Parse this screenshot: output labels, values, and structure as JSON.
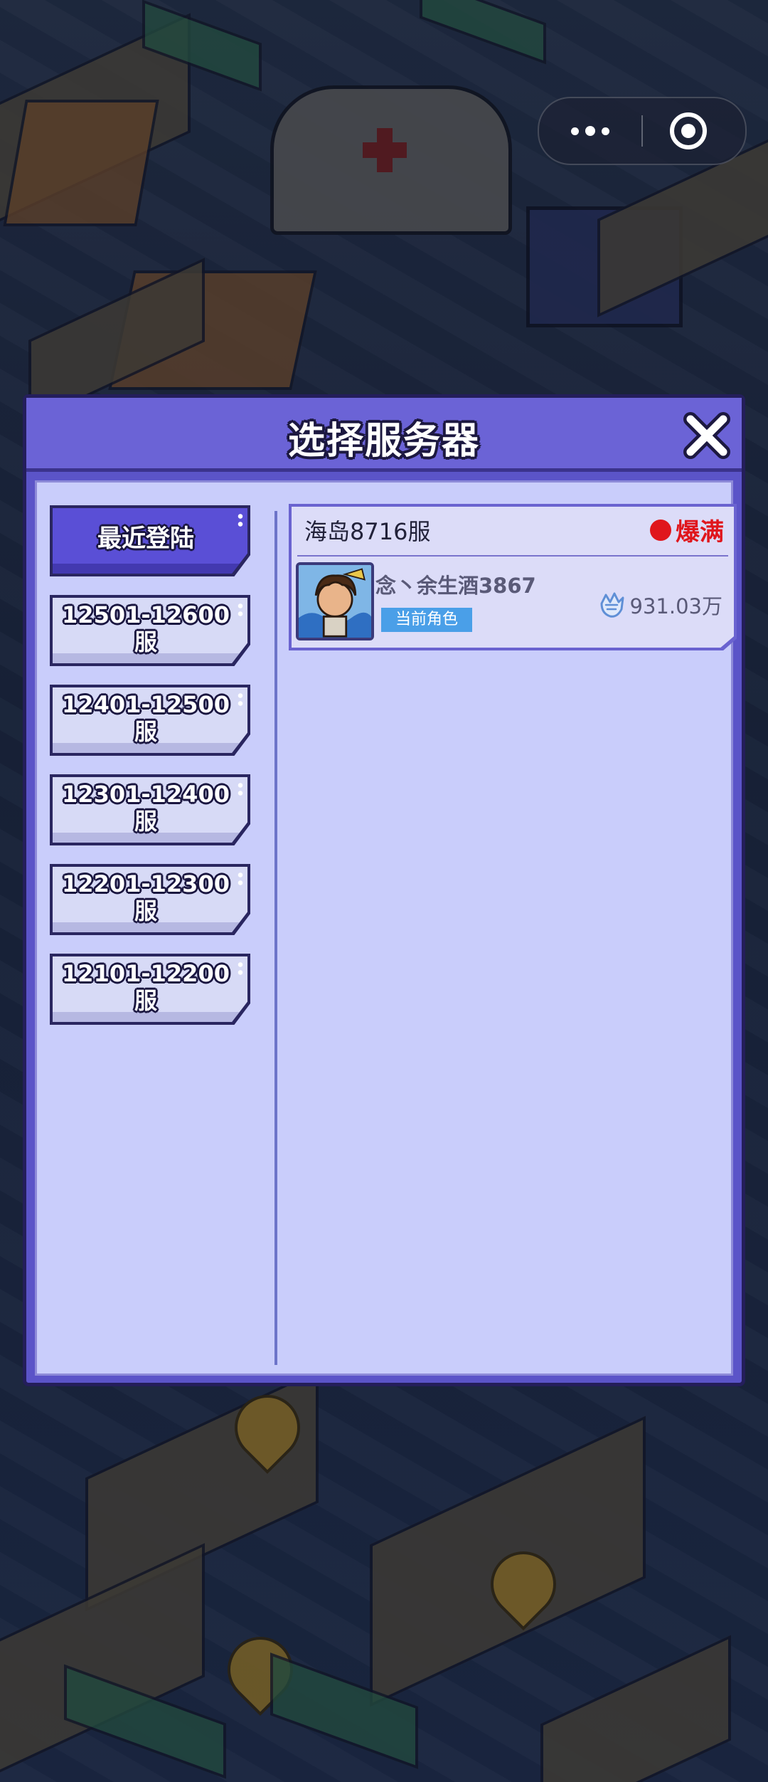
{
  "capsule": {
    "more_icon": "more-dots-icon",
    "close_icon": "mini-program-close-icon"
  },
  "dialog": {
    "title": "选择服务器",
    "close_icon": "close-x-icon"
  },
  "categories": [
    {
      "label": "最近登陆",
      "active": true
    },
    {
      "label": "12501-12600服",
      "active": false
    },
    {
      "label": "12401-12500服",
      "active": false
    },
    {
      "label": "12301-12400服",
      "active": false
    },
    {
      "label": "12201-12300服",
      "active": false
    },
    {
      "label": "12101-12200服",
      "active": false
    }
  ],
  "server": {
    "name": "海岛8716服",
    "status_label": "爆满",
    "status_color": "#e0161c",
    "role_name": "念丶余生酒3867",
    "role_tag": "当前角色",
    "power_value": "931.03万",
    "power_icon": "fist-power-icon",
    "avatar_icon": "character-avatar"
  },
  "colors": {
    "dialog_bg": "#5b54c8",
    "panel_bg": "#c9cdfb",
    "active_tab": "#5a4fd6",
    "tag_bg": "#4a9fe8"
  }
}
